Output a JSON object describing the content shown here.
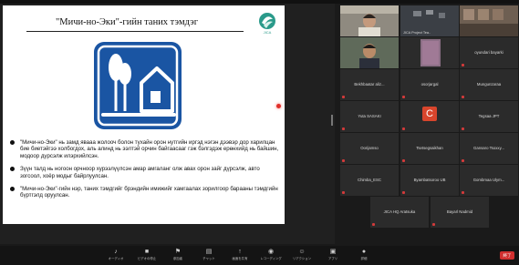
{
  "slide": {
    "title": "\"Мичи-но-Эки\"-гийн таних тэмдэг",
    "logo_text": "JICA",
    "bullets": [
      "\"Мичи-но-Эки\" нь замд явааа жолооч болон тухайн орон нутгийн иргэд нэгэн дээвэр дор харилцан бие биетэйгээ холбогдох, аль алинд нь ээлтэй орчин байгаасааг гэж бэлгэдэж ерөнхийд нь байшин, модоор дүрсэлж илэрхийлсэн.",
      "Зүүн талд нь ногоон орчноор хурээлүүлсэн амар амгаланг олж авах орон зайг дүрсэлж, авто зогсоол, хоёр модыг байрлуулсан.",
      "\"Мичи-но-Эки\"-гийн нэр, таних тэмдгийг брэндийн имижийг хамгаалах зорилгоор барааны тэмдгийн бүртгэлд оруулсан."
    ]
  },
  "participants": [
    {
      "name": "",
      "kind": "video"
    },
    {
      "name": "JICA Project Tea..",
      "kind": "video"
    },
    {
      "name": "",
      "kind": "video"
    },
    {
      "name": "",
      "kind": "video"
    },
    {
      "name": "",
      "kind": "video"
    },
    {
      "name": "oyundari bayarki",
      "kind": "name"
    },
    {
      "name": "Bekhbaatar aliz...",
      "kind": "name"
    },
    {
      "name": "osorjargal",
      "kind": "name"
    },
    {
      "name": "Mungunzaraa",
      "kind": "name"
    },
    {
      "name": "Yuta SASAKI",
      "kind": "name"
    },
    {
      "name": "",
      "kind": "avatar",
      "initial": "C"
    },
    {
      "name": "Tegsaa JPT",
      "kind": "name"
    },
    {
      "name": "Oorijamso",
      "kind": "name"
    },
    {
      "name": "Tsetsegsaikhan",
      "kind": "name"
    },
    {
      "name": "Gansaro Tsoxxy...",
      "kind": "name"
    },
    {
      "name": "Chimba_ESC",
      "kind": "name"
    },
    {
      "name": "Byambatsoroo UB",
      "kind": "name"
    },
    {
      "name": "Gombmaa Ulym...",
      "kind": "name"
    },
    {
      "name": "JICA HQ Aratsuka",
      "kind": "name"
    },
    {
      "name": "Bayarl Nadmid",
      "kind": "name"
    }
  ],
  "toolbar": {
    "items": [
      {
        "icon": "♪",
        "label": "オーディオ"
      },
      {
        "icon": "■",
        "label": "ビデオの停止"
      },
      {
        "icon": "⚑",
        "label": "参加者"
      },
      {
        "icon": "▤",
        "label": "チャット"
      },
      {
        "icon": "↑",
        "label": "画面を共有"
      },
      {
        "icon": "◉",
        "label": "レコーディング"
      },
      {
        "icon": "☺",
        "label": "リアクション"
      },
      {
        "icon": "▣",
        "label": "アプリ"
      },
      {
        "icon": "●",
        "label": "詳細"
      }
    ],
    "end_label": "終了"
  },
  "colors": {
    "sign_blue": "#1a55a3",
    "speaker_green": "#52c152",
    "end_red": "#d12f2f"
  }
}
